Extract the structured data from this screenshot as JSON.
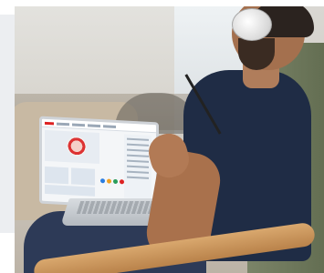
{
  "scene": {
    "description_icon": "person-using-laptop-photo",
    "colors": {
      "shirt": "#1f2c45",
      "headphones": "#ffffff",
      "chair_wood": "#c8915a",
      "chair_cushion": "#6b7558",
      "site_accent": "#d22222"
    }
  },
  "laptop_site": {
    "icons": [
      "logo-icon",
      "seal-icon",
      "badge-icon"
    ]
  }
}
